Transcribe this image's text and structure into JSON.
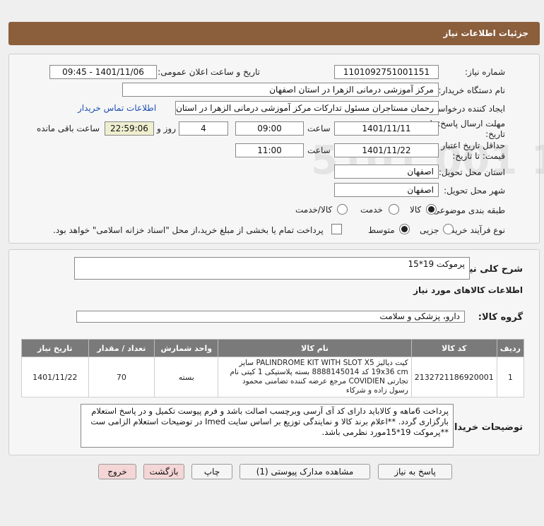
{
  "page": {
    "title": "جزئیات اطلاعات نیاز"
  },
  "fields": {
    "need_number_label": "شماره نیاز:",
    "need_number": "1101092751001151",
    "announce_label": "تاریخ و ساعت اعلان عمومی:",
    "announce_value": "1401/11/06 - 09:45",
    "buyer_label": "نام دستگاه خریدار:",
    "buyer_value": "مرکز آموزشی درمانی الزهرا در استان اصفهان",
    "creator_label": "ایجاد کننده درخواست:",
    "creator_value": "رحمان مستاجران مسئول تدارکات مرکز آموزشی درمانی الزهرا در استان اصفهان",
    "contact_link": "اطلاعات تماس خریدار",
    "deadline_label_1": "مهلت ارسال پاسخ: تا",
    "deadline_label_2": "تاریخ:",
    "deadline_date": "1401/11/11",
    "time_label": "ساعت",
    "deadline_time": "09:00",
    "days_value": "4",
    "days_label": "روز و",
    "remaining_time": "22:59:06",
    "remaining_label": "ساعت باقی مانده",
    "validity_label_1": "حداقل تاریخ اعتبار",
    "validity_label_2": "قیمت: تا تاریخ:",
    "validity_date": "1401/11/22",
    "validity_time_label": "ساعت",
    "validity_time": "11:00",
    "province_label": "استان محل تحویل:",
    "province_value": "اصفهان",
    "city_label": "شهر محل تحویل:",
    "city_value": "اصفهان",
    "category_label": "طبقه بندی موضوعی:",
    "category_options": [
      "کالا",
      "خدمت",
      "کالا/خدمت"
    ],
    "category_selected": "کالا",
    "process_label": "نوع فرآیند خرید :",
    "process_options": [
      "جزیی",
      "متوسط"
    ],
    "process_selected": "متوسط",
    "payment_note": "پرداخت تمام یا بخشی از مبلغ خرید،از محل \"اسناد خزانه اسلامی\" خواهد بود."
  },
  "summary": {
    "description_label": "شرح کلی نیاز:",
    "description_value": "پرموکت 19*15",
    "goods_info_title": "اطلاعات کالاهای مورد نیاز",
    "goods_group_label": "گروه کالا:",
    "goods_group_value": "دارو، پزشکی و سلامت"
  },
  "table": {
    "headers": [
      "ردیف",
      "کد کالا",
      "نام کالا",
      "واحد شمارش",
      "تعداد / مقدار",
      "تاریخ نیاز"
    ],
    "rows": [
      {
        "row": "1",
        "code": "2132721186920001",
        "name": "کیت دیالیز PALINDROME KIT WITH SLOT X5 سایز 19x36 cm کد 8888145014 بسته پلاستیکی 1 کیتی نام تجارتی COVIDIEN مرجع عرضه کننده تضامنی محمود رسول زاده و شرکاء",
        "unit": "بسته",
        "qty": "70",
        "date": "1401/11/22"
      }
    ]
  },
  "buyer_notes": {
    "label": "توضیحات خریدار:",
    "text": "پرداخت 6ماهه و  کالاباید دارای کد آی آرسی وبرچسب اصالت باشد و فرم پیوست تکمیل و در پاسخ استعلام بارگزاری گردد. **اعلام برند کالا و نمایندگی توزیع بر اساس سایت Imed در توضیحات استعلام الزامی ست **پرموکت 19*15مورد نظرمی باشد."
  },
  "buttons": {
    "reply": "پاسخ به نیاز",
    "attachments": "مشاهده مدارک پیوستی (1)",
    "print": "چاپ",
    "back": "بازگشت",
    "exit": "خروج"
  },
  "watermark": {
    "brand": "ParsNamadData",
    "persian_line": "مرکز فراوری اطلاعات پارس نماد داده",
    "persian_line2": "پایگاه اطلاع رسانی مناقصات ایران",
    "phone": "۰۲۱-۸۸۳۴۹۶۷۰"
  },
  "colors": {
    "header": "#8b5e3c",
    "table_header": "#7a7a7a",
    "link": "#1f4fb5"
  }
}
